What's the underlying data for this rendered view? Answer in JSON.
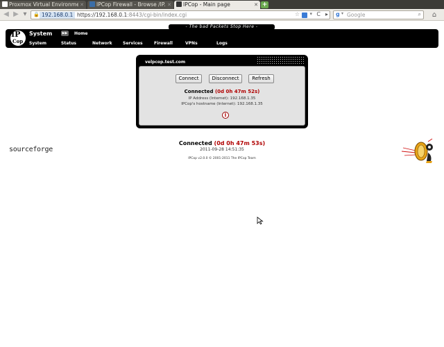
{
  "browser": {
    "tabs": [
      {
        "title": "Proxmox Virtual Environment",
        "active": false,
        "favicon_color": "#ffffff"
      },
      {
        "title": "IPCop Firewall - Browse /IP...",
        "active": false,
        "favicon_color": "#3b6ea8"
      },
      {
        "title": "IPCop - Main page",
        "active": true,
        "favicon_color": "#333333"
      }
    ],
    "url": {
      "domain": "192.168.0.1",
      "scheme_host": "https://192.168.0.1",
      "port_path": ":8443/cgi-bin/index.cgi"
    },
    "search": {
      "engine_icon": "g",
      "placeholder": "Google"
    }
  },
  "ipcop": {
    "banner": "- The bad Packets Stop Here -",
    "logo_top": "IP",
    "logo_bottom": "Cop",
    "section_title": "System",
    "home_link": "Home",
    "menu": [
      "System",
      "Status",
      "Network",
      "Services",
      "Firewall",
      "VPNs",
      "Logs"
    ],
    "hostname": "velpcop.test.com",
    "buttons": {
      "connect": "Connect",
      "disconnect": "Disconnect",
      "refresh": "Refresh"
    },
    "connection": {
      "label": "Connected",
      "duration": "(0d 0h 47m 52s)",
      "ip_line": "IP Address (Internet): 192.168.1.35",
      "hostname_line": "IPCop's hostname (Internet): 192.168.1.35"
    },
    "info_icon": "i"
  },
  "footer": {
    "sourceforge": "sourceforge",
    "status_label": "Connected",
    "status_duration": "(0d 0h 47m 53s)",
    "date": "2011-09-28 14:51:35",
    "copyright": "IPCop v2.0.0 © 2001-2011 The IPCop Team"
  },
  "colors": {
    "accent_red": "#b00000",
    "header_black": "#000000"
  }
}
